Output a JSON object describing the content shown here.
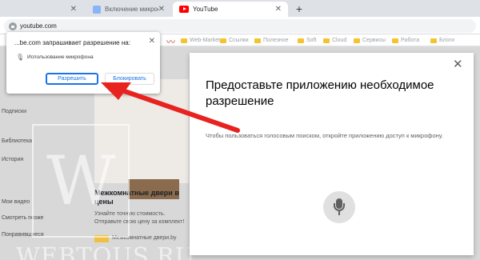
{
  "tabs": [
    {
      "title": "",
      "state": "inactive"
    },
    {
      "title": "Включение микрофона на YouTube в бра",
      "state": "inactive"
    },
    {
      "title": "YouTube",
      "state": "active"
    }
  ],
  "address_bar": {
    "url": "youtube.com"
  },
  "bookmarks": [
    "Web-Market",
    "Ссылки",
    "Полезное",
    "Soft",
    "Cloud",
    "Сервисы",
    "Работа",
    "Блоги"
  ],
  "background_page": {
    "sidebar_items": [
      "Подписки",
      "Библиотека",
      "История",
      "Мои видео",
      "Смотреть позже",
      "Понравившиеся"
    ],
    "video_title": "Межкомнатные двери в цены",
    "video_description": "Узнайте точную стоимость. Отправьте свою цену за комплект!",
    "video_source": "Межкомнатные двери.by",
    "watermark": "WEBTOUS.RU",
    "watermark_letter": "W"
  },
  "permission_popup": {
    "title": "...be.com запрашивает разрешение на:",
    "permission": "Использование микрофона",
    "allow_label": "Разрешить",
    "block_label": "Блокировать"
  },
  "youtube_dialog": {
    "title": "Предоставьте приложению необходимое разрешение",
    "body": "Чтобы пользоваться голосовым поиском, откройте приложению доступ к микрофону."
  },
  "colors": {
    "arrow": "#e8231f",
    "accent": "#1a73e8",
    "youtube_red": "#ff0000"
  },
  "icons": [
    "lock-icon",
    "close-icon",
    "microphone-icon",
    "new-tab-icon",
    "folder-icon",
    "chart-icon"
  ]
}
